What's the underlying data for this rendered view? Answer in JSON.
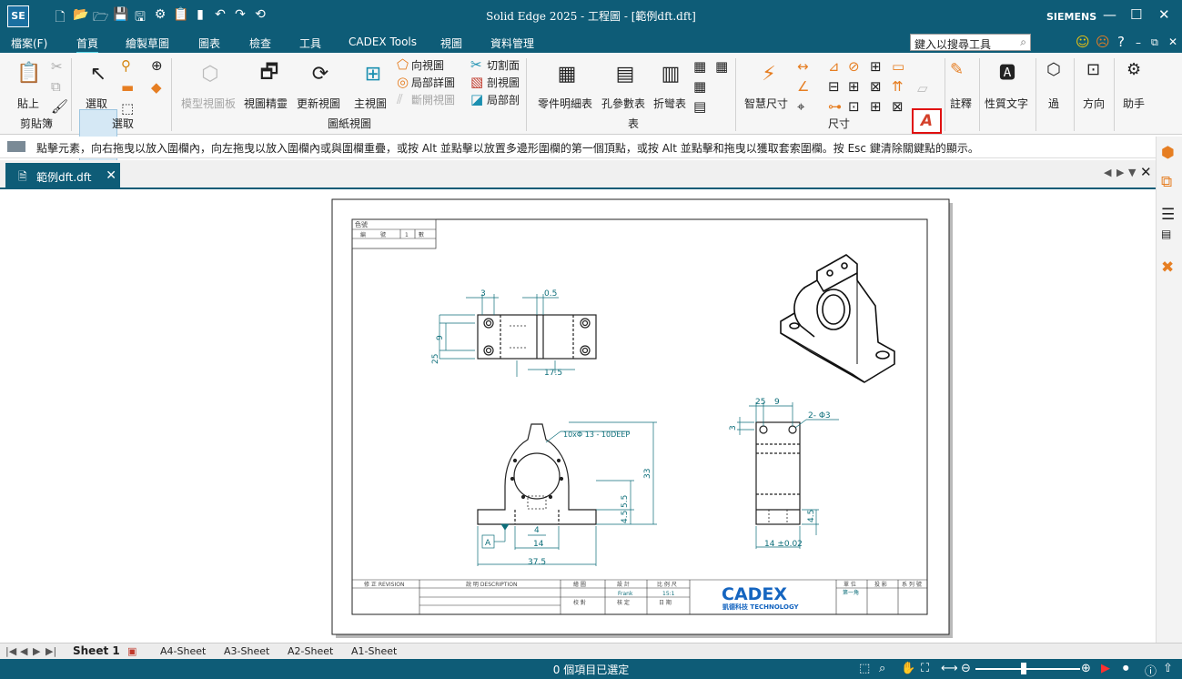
{
  "window": {
    "app_icon": "SE",
    "title": "Solid Edge 2025 - 工程圖 - [範例dft.dft]",
    "brand": "SIEMENS",
    "qat_icons": [
      "new-icon",
      "open-icon",
      "open-recent-icon",
      "save-icon",
      "save-as-icon",
      "gear-icon",
      "clipboard-icon",
      "trace-icon",
      "undo-icon",
      "redo-icon",
      "repeat-icon"
    ]
  },
  "menu": {
    "items": [
      "檔案(F)",
      "首頁",
      "繪製草圖",
      "圖表",
      "檢查",
      "工具",
      "CADEX Tools",
      "視圖",
      "資料管理"
    ],
    "active": "首頁"
  },
  "search": {
    "placeholder": "鍵入以搜尋工具"
  },
  "ribbon": {
    "clipboard": {
      "paste": "貼上",
      "group": "剪貼簿"
    },
    "select": {
      "select": "選取",
      "group": "選取"
    },
    "drawing_views": {
      "model_view": "模型視圖板",
      "view_wizard": "視圖精靈",
      "update_view": "更新視圖",
      "main_view": "主視圖",
      "direction_view": "向視圖",
      "detail_view": "局部詳圖",
      "broken_view": "斷開視圖",
      "cutting_plane": "切割面",
      "section_view": "剖視圖",
      "partial_section": "局部剖",
      "group": "圖紙視圖"
    },
    "tables": {
      "parts_list": "零件明細表",
      "hole_table": "孔參數表",
      "bend_table": "折彎表",
      "group": "表"
    },
    "dimension": {
      "smart_dim": "智慧尺寸",
      "group": "尺寸"
    },
    "annotation": {
      "label": "註釋"
    },
    "property_text": {
      "label": "性質文字"
    },
    "filter": {
      "label": "過"
    },
    "orient": {
      "label": "方向"
    },
    "assistant": {
      "label": "助手"
    },
    "highlight_color": "#e01010"
  },
  "prompt": {
    "text": "點擊元素，向右拖曳以放入圍欄內，向左拖曳以放入圍欄內或與圍欄重疊，或按 Alt 並點擊以放置多邊形圍欄的第一個頂點，或按 Alt 並點擊和拖曳以獲取套索圍欄。按 Esc 鍵清除關鍵點的顯示。"
  },
  "doc_tab": {
    "label": "範例dft.dft"
  },
  "drawing": {
    "legend": {
      "title": "色號",
      "cols": [
        "編",
        "號",
        "1",
        "數"
      ]
    },
    "dims_top": {
      "d1": "3",
      "d2": "0.5",
      "d3": "9",
      "d4": "25",
      "d5": "17.5"
    },
    "dims_front": {
      "note": "10xΦ 13 - 10DEEP",
      "d1": "33",
      "d2": "5.5",
      "d3": "4.5",
      "d4": "4",
      "d5": "14",
      "d6": "37.5",
      "datum": "A"
    },
    "dims_side": {
      "d1": "25",
      "d2": "9",
      "d3": "2- Φ3",
      "d4": "3",
      "d5": "4.5",
      "d6": "14 ±0.02"
    },
    "title_block": {
      "revision": "修 正 REVISION",
      "desc": "說 明 DESCRIPTION",
      "drawn": "繪 圖",
      "design": "設 計",
      "scale": "比 例 尺",
      "designer": "Frank",
      "scale_val": "15:1",
      "check": "校 對",
      "approve": "核 定",
      "date": "日 期",
      "company": "CADEX",
      "company_sub": "凱德科技 TECHNOLOGY",
      "unit": "單 位",
      "proj": "投 影",
      "series": "系 列 號",
      "dir": "第一角",
      "brand_color": "#1565c0"
    }
  },
  "sheets": [
    "Sheet 1",
    "A4-Sheet",
    "A3-Sheet",
    "A2-Sheet",
    "A1-Sheet"
  ],
  "status": {
    "text": "0 個項目已選定"
  },
  "colors": {
    "teal": "#0e5c77",
    "dim": "#0d6e7a"
  }
}
